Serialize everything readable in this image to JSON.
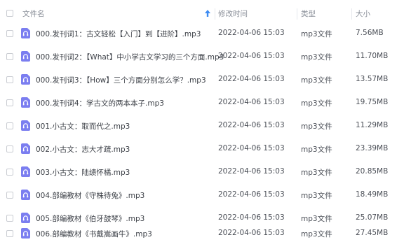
{
  "header": {
    "name_label": "文件名",
    "time_label": "修改时间",
    "type_label": "类型",
    "size_label": "大小"
  },
  "colors": {
    "accent": "#3d8bf2",
    "file_icon": "#7b7ef0"
  },
  "rows": [
    {
      "name": "000.发刊词1：古文轻松【入门】到【进阶】.mp3",
      "time": "2022-04-06 15:03",
      "type": "mp3文件",
      "size": "7.56MB"
    },
    {
      "name": "000.发刊词2：【What】中小学古文学习的三个方面.mp3",
      "time": "2022-04-06 15:03",
      "type": "mp3文件",
      "size": "11.70MB"
    },
    {
      "name": "000.发刊词3：【How】三个方面分别怎么学？.mp3",
      "time": "2022-04-06 15:03",
      "type": "mp3文件",
      "size": "13.57MB"
    },
    {
      "name": "000.发刊词4：学古文的两本本子.mp3",
      "time": "2022-04-06 15:03",
      "type": "mp3文件",
      "size": "19.75MB"
    },
    {
      "name": "001.小古文：取而代之.mp3",
      "time": "2022-04-06 15:03",
      "type": "mp3文件",
      "size": "11.29MB"
    },
    {
      "name": "002.小古文：志大才疏.mp3",
      "time": "2022-04-06 15:03",
      "type": "mp3文件",
      "size": "23.39MB"
    },
    {
      "name": "003.小古文：陆绩怀橘.mp3",
      "time": "2022-04-06 15:03",
      "type": "mp3文件",
      "size": "20.85MB"
    },
    {
      "name": "004.部编教材《守株待兔》.mp3",
      "time": "2022-04-06 15:03",
      "type": "mp3文件",
      "size": "18.49MB"
    },
    {
      "name": "005.部编教材《伯牙鼓琴》.mp3",
      "time": "2022-04-06 15:03",
      "type": "mp3文件",
      "size": "25.07MB"
    },
    {
      "name": "006.部编教材《书戴嵩画牛》.mp3",
      "time": "2022-04-06 15:03",
      "type": "mp3文件",
      "size": "27.45MB"
    }
  ]
}
